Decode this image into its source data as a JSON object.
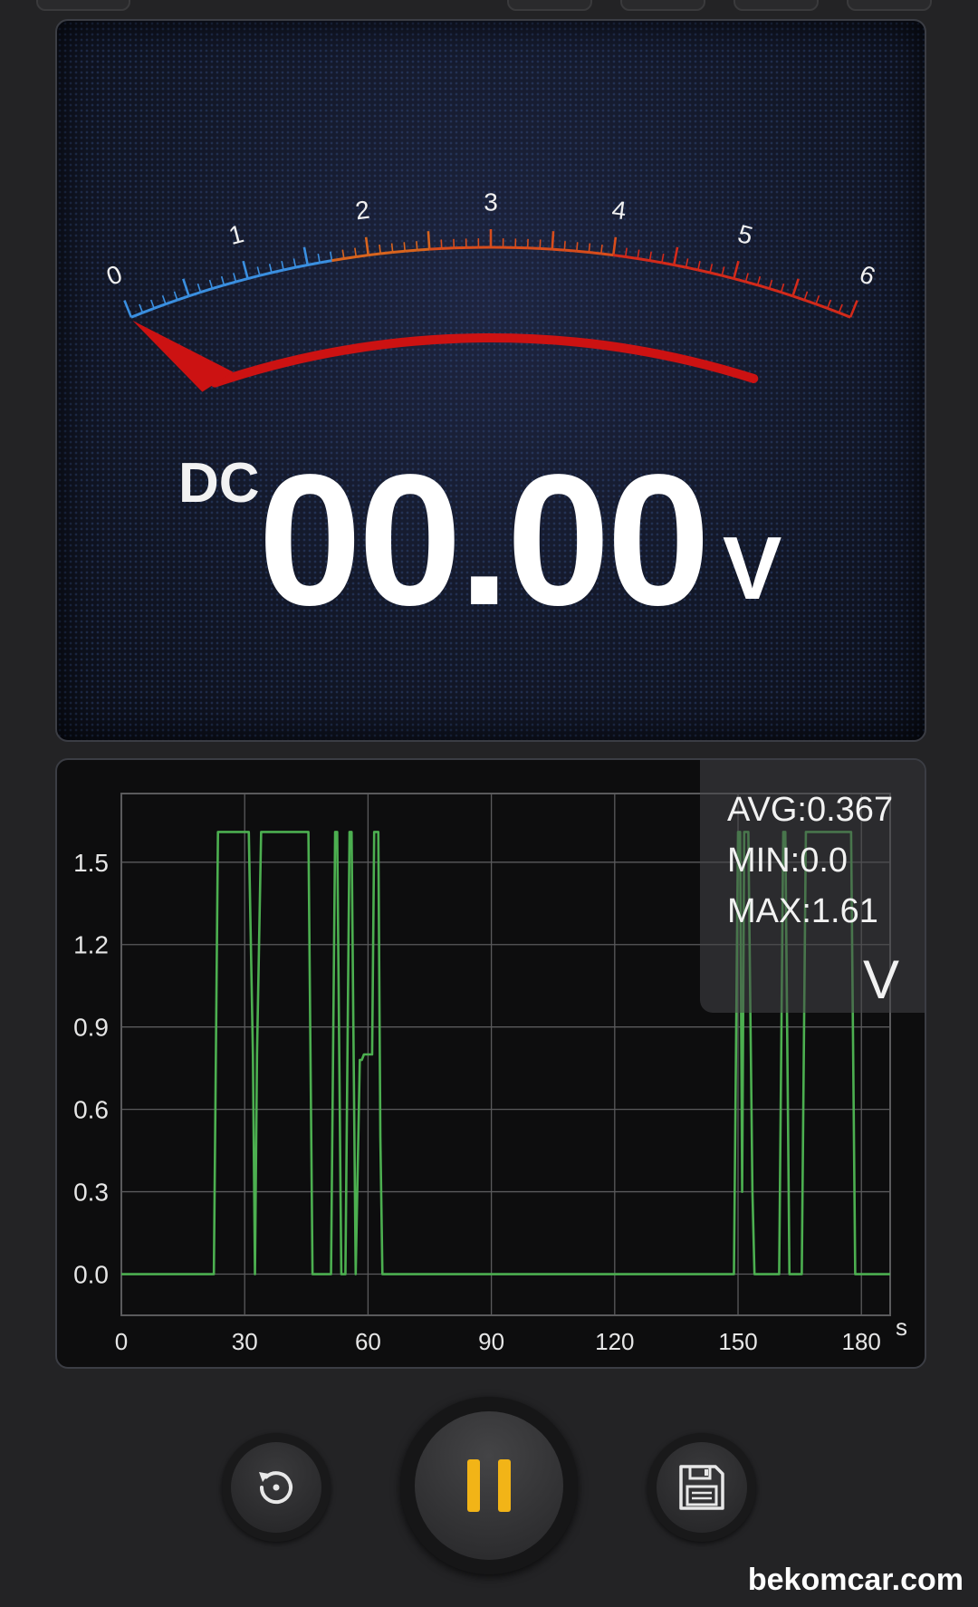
{
  "meter": {
    "mode": "DC",
    "reading": "00.00",
    "unit": "V",
    "scale_labels": [
      "0",
      "1",
      "2",
      "3",
      "4",
      "5",
      "6"
    ],
    "needle_value": 0,
    "scale_min": 0,
    "scale_max": 6
  },
  "chart": {
    "unit": "V",
    "x_unit": "s",
    "stats": {
      "avg": "AVG:0.367",
      "min": "MIN:0.0",
      "max": "MAX:1.61"
    }
  },
  "chart_data": {
    "type": "line",
    "xlim": [
      0,
      187
    ],
    "ylim": [
      -0.15,
      1.75
    ],
    "xticks": [
      0,
      30,
      60,
      90,
      120,
      150,
      180
    ],
    "xtick_labels": [
      "0",
      "30",
      "60",
      "90",
      "120",
      "150",
      "180"
    ],
    "yticks": [
      0.0,
      0.3,
      0.6,
      0.9,
      1.2,
      1.5
    ],
    "ytick_labels": [
      "0.0",
      "0.3",
      "0.6",
      "0.9",
      "1.2",
      "1.5"
    ],
    "grid": true,
    "series": [
      {
        "color": "#4caf50",
        "x": [
          0,
          22.5,
          23.5,
          31,
          32,
          32.5,
          33,
          34,
          45.5,
          46.5,
          51,
          52,
          52.5,
          53.5,
          54.5,
          55.5,
          56,
          57,
          58,
          58.5,
          59,
          61,
          61.5,
          62.5,
          63,
          63.5,
          149,
          150,
          150.5,
          151,
          151.5,
          152.5,
          153.5,
          154,
          160,
          161,
          161.5,
          162.5,
          165.5,
          166.5,
          177.5,
          178.5,
          187
        ],
        "y": [
          0,
          0,
          1.61,
          1.61,
          0.8,
          0,
          0.8,
          1.61,
          1.61,
          0,
          0,
          1.61,
          1.61,
          0,
          0,
          1.61,
          1.61,
          0,
          0.78,
          0.78,
          0.8,
          0.8,
          1.61,
          1.61,
          0.5,
          0,
          0,
          1.61,
          1.61,
          0.3,
          1.61,
          1.61,
          0.3,
          0,
          0,
          1.61,
          1.61,
          0,
          0,
          1.61,
          1.61,
          0,
          0
        ]
      }
    ]
  },
  "controls": {
    "reset_icon": "reset-icon",
    "pause_icon": "pause-icon",
    "save_icon": "save-icon"
  },
  "watermark": "bekomcar.com"
}
